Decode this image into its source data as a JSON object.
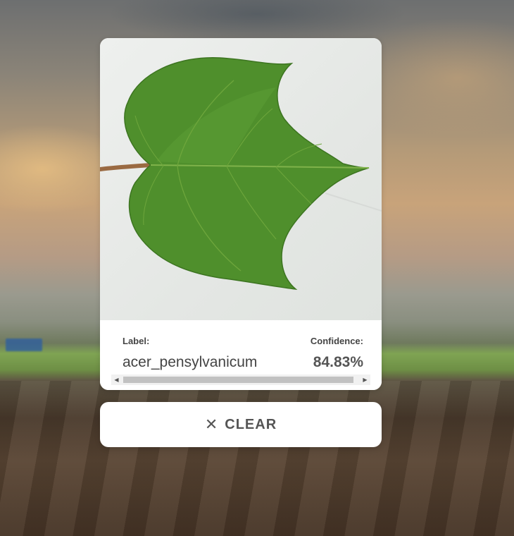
{
  "result": {
    "label_heading": "Label:",
    "label_value": "acer_pensylvanicum",
    "confidence_heading": "Confidence:",
    "confidence_value": "84.83%"
  },
  "clear_button": {
    "icon": "close-icon",
    "label": "CLEAR"
  },
  "image": {
    "subject": "leaf-photo"
  }
}
